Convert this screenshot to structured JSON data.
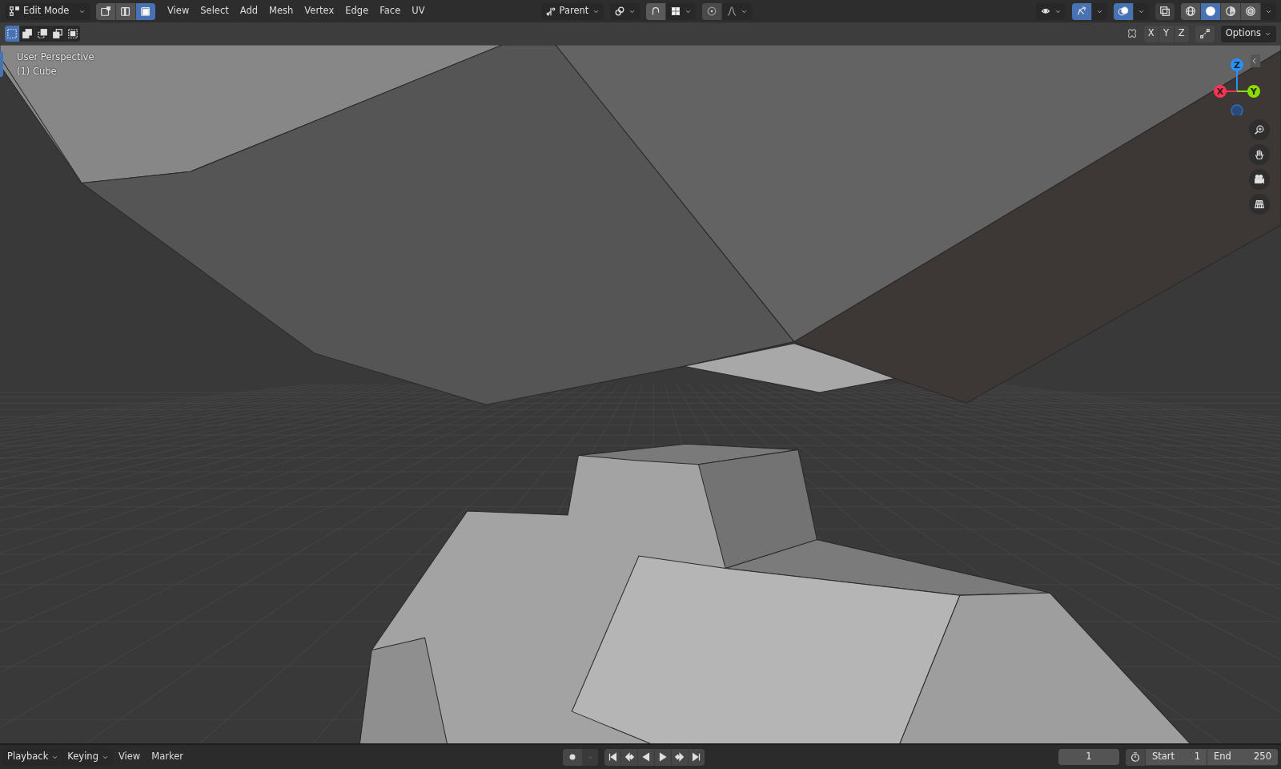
{
  "header": {
    "mode": "Edit Mode",
    "select_modes": [
      {
        "kind": "vertex",
        "selected": false
      },
      {
        "kind": "edge",
        "selected": false
      },
      {
        "kind": "face",
        "selected": true
      }
    ],
    "menus": [
      "View",
      "Select",
      "Add",
      "Mesh",
      "Vertex",
      "Edge",
      "Face",
      "UV"
    ],
    "pivot": "Parent",
    "snap_on": false,
    "proportional_on": false,
    "gizmo_on": true,
    "overlay_on": true,
    "shading": [
      {
        "kind": "wireframe",
        "selected": false
      },
      {
        "kind": "solid",
        "selected": true
      },
      {
        "kind": "material",
        "selected": false
      },
      {
        "kind": "rendered",
        "selected": false
      }
    ]
  },
  "tool_header": {
    "select_box_modes": [
      {
        "kind": "new",
        "selected": true
      },
      {
        "kind": "extend",
        "selected": false
      },
      {
        "kind": "subtract",
        "selected": false
      },
      {
        "kind": "invert",
        "selected": false
      },
      {
        "kind": "intersect",
        "selected": false
      }
    ],
    "mirror_axes": [
      "X",
      "Y",
      "Z"
    ],
    "options": "Options"
  },
  "viewport": {
    "view_name": "User Perspective",
    "object": "(1) Cube",
    "axes": [
      "X",
      "Y",
      "Z"
    ]
  },
  "timeline": {
    "dropdown_menus": [
      "Playback",
      "Keying"
    ],
    "menus": [
      "View",
      "Marker"
    ],
    "current_frame": "1",
    "start_label": "Start",
    "start": "1",
    "end_label": "End",
    "end": "250"
  }
}
